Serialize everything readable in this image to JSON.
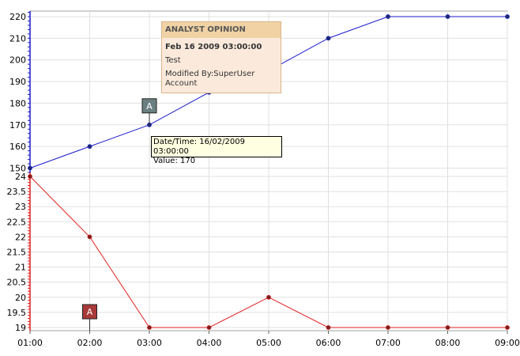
{
  "colors": {
    "top_series": "#1a1acc",
    "bottom_series": "#e02020",
    "grid": "#e0e0e0",
    "marker_top": "#1c2a6e",
    "marker_bottom": "#7a1f1f",
    "annotation_top": "#6b8080",
    "annotation_bottom": "#a83a3a"
  },
  "chart_data": [
    {
      "type": "line",
      "x": [
        "01:00",
        "02:00",
        "03:00",
        "04:00",
        "05:00",
        "06:00",
        "07:00",
        "08:00",
        "09:00"
      ],
      "series": [
        {
          "values": [
            150,
            160,
            170,
            185,
            195,
            210,
            220,
            220,
            220
          ]
        }
      ],
      "ylim": [
        148,
        222
      ],
      "yticks": [
        "150",
        "160",
        "170",
        "180",
        "190",
        "200",
        "210",
        "220"
      ],
      "grid": true,
      "annotation": {
        "label": "A",
        "at": "03:00"
      }
    },
    {
      "type": "line",
      "x": [
        "01:00",
        "02:00",
        "03:00",
        "04:00",
        "05:00",
        "06:00",
        "07:00",
        "08:00",
        "09:00"
      ],
      "series": [
        {
          "values": [
            24,
            22,
            19,
            19,
            20,
            19,
            19,
            19,
            19
          ]
        }
      ],
      "ylim": [
        18.95,
        24
      ],
      "yticks": [
        "19",
        "19.5",
        "20",
        "20.5",
        "21",
        "21.5",
        "22",
        "22.5",
        "23",
        "23.5",
        "24"
      ],
      "grid": true,
      "annotation": {
        "label": "A",
        "at": "02:00"
      }
    }
  ],
  "popup": {
    "title": "ANALYST OPINION",
    "date": "Feb 16 2009 03:00:00",
    "text": "Test",
    "modified": "Modified By:SuperUser Account"
  },
  "tooltip": {
    "line1": "Date/Time: 16/02/2009 03:00:00",
    "line2": "Value: 170"
  }
}
